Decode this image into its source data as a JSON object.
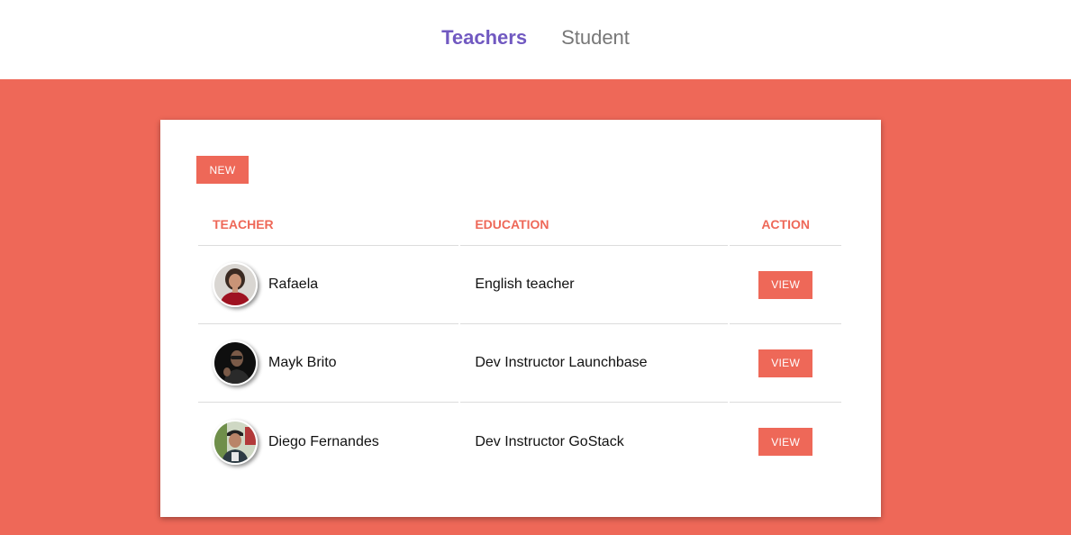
{
  "nav": {
    "items": [
      {
        "label": "Teachers",
        "active": true
      },
      {
        "label": "Student",
        "active": false
      }
    ]
  },
  "colors": {
    "accent": "#ee6858",
    "nav_active": "#7159c1",
    "nav_inactive": "#777777"
  },
  "card": {
    "new_label": "NEW",
    "table": {
      "headers": {
        "teacher": "TEACHER",
        "education": "EDUCATION",
        "action": "ACTION"
      },
      "rows": [
        {
          "name": "Rafaela",
          "education": "English teacher",
          "action_label": "VIEW",
          "avatar": "avatar-photo-rafaela"
        },
        {
          "name": "Mayk Brito",
          "education": "Dev Instructor Launchbase",
          "action_label": "VIEW",
          "avatar": "avatar-photo-mayk"
        },
        {
          "name": "Diego Fernandes",
          "education": "Dev Instructor GoStack",
          "action_label": "VIEW",
          "avatar": "avatar-photo-diego"
        }
      ]
    }
  }
}
